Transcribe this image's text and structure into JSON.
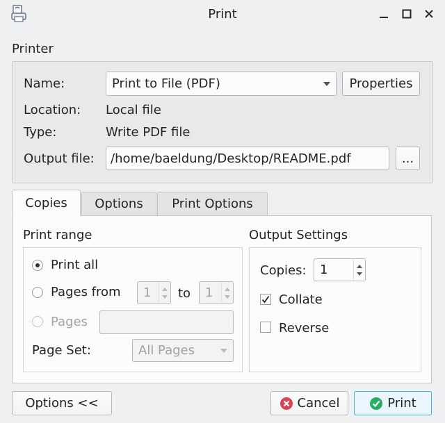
{
  "window": {
    "title": "Print",
    "icons": {
      "app": "print-app-icon",
      "minimize": "minimize-icon",
      "maximize": "maximize-icon",
      "close": "close-icon"
    }
  },
  "printer": {
    "group_label": "Printer",
    "name_label": "Name:",
    "name_value": "Print to File (PDF)",
    "properties_label": "Properties",
    "location_label": "Location:",
    "location_value": "Local file",
    "type_label": "Type:",
    "type_value": "Write PDF file",
    "output_label": "Output file:",
    "output_value": "/home/baeldung/Desktop/README.pdf",
    "browse_label": "..."
  },
  "tabs": [
    {
      "label": "Copies",
      "active": true
    },
    {
      "label": "Options",
      "active": false
    },
    {
      "label": "Print Options",
      "active": false
    }
  ],
  "print_range": {
    "label": "Print range",
    "print_all": "Print all",
    "pages_from": "Pages from",
    "from_value": "1",
    "to_label": "to",
    "to_value": "1",
    "pages": "Pages",
    "pages_value": "",
    "page_set_label": "Page Set:",
    "page_set_value": "All Pages",
    "selected": "Print all"
  },
  "output_settings": {
    "label": "Output Settings",
    "copies_label": "Copies:",
    "copies_value": "1",
    "collate_label": "Collate",
    "collate_checked": true,
    "reverse_label": "Reverse",
    "reverse_checked": false
  },
  "footer": {
    "options_label": "Options <<",
    "cancel_label": "Cancel",
    "print_label": "Print"
  },
  "colors": {
    "cancel_icon": "#da4453",
    "print_icon": "#27ae60",
    "focus_border": "#3daee9"
  }
}
